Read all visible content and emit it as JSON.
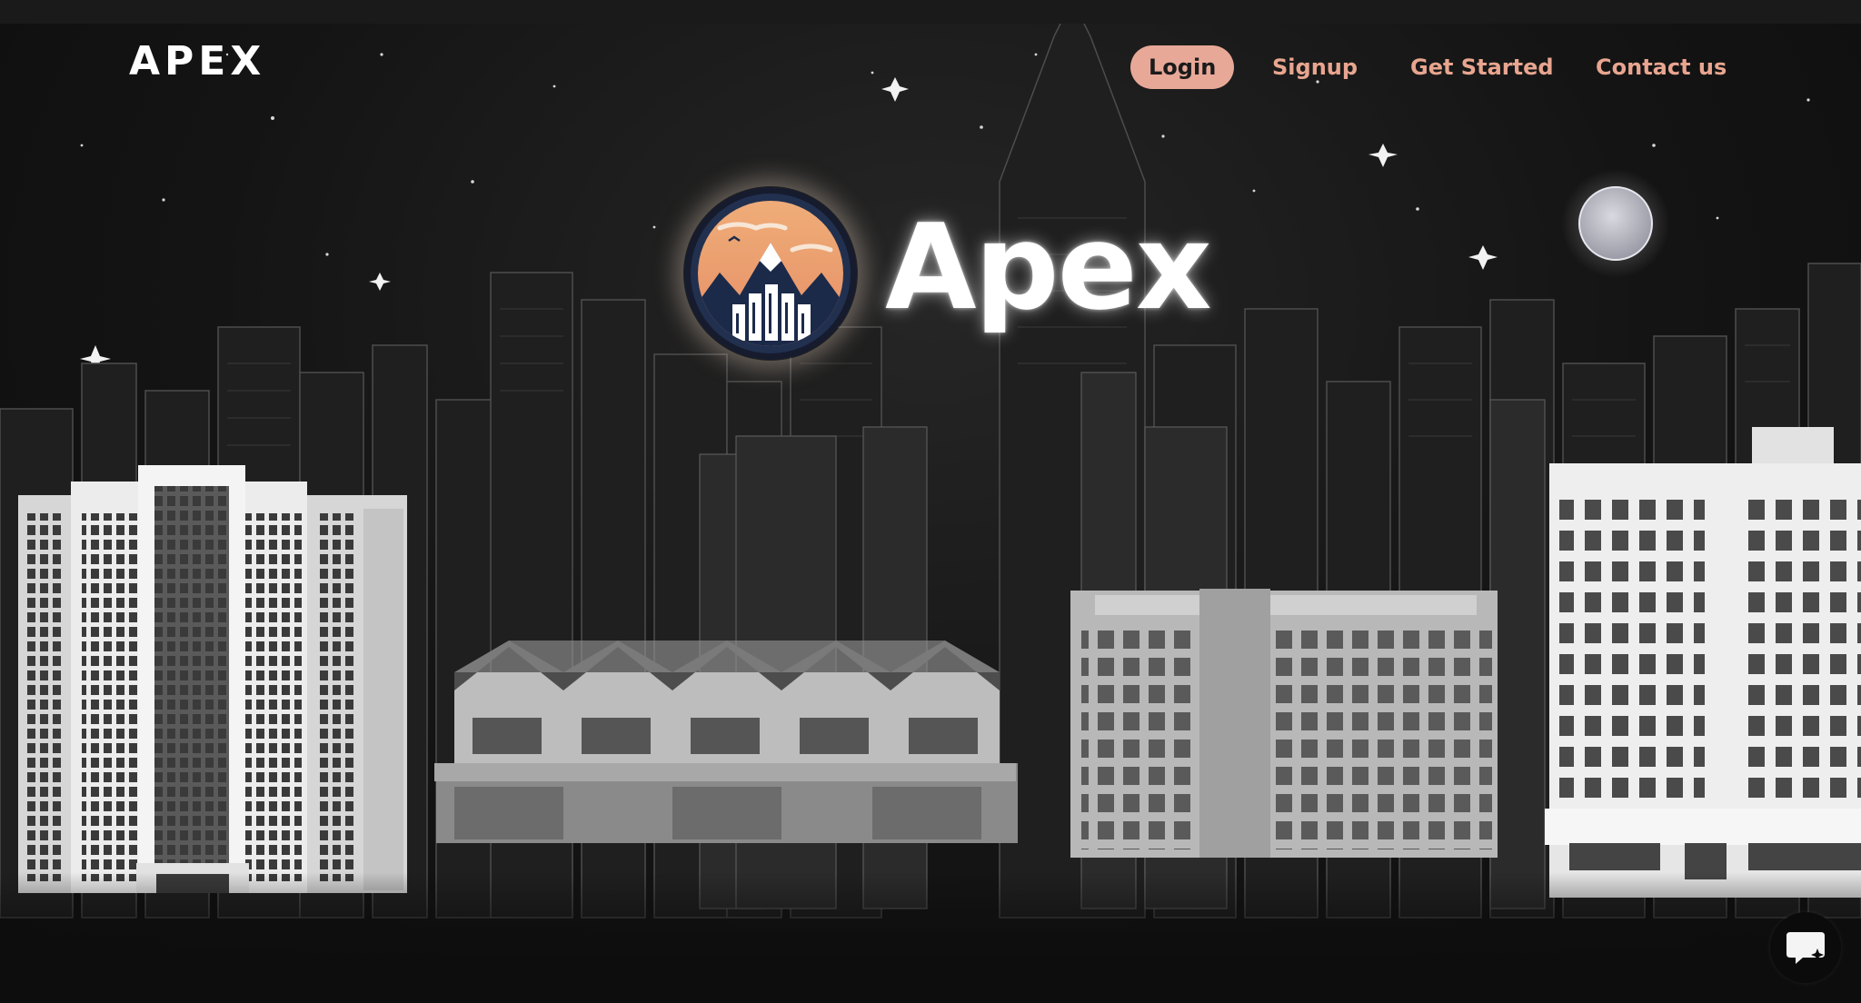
{
  "brand": {
    "name": "APEX"
  },
  "nav": {
    "login": "Login",
    "signup": "Signup",
    "get_started": "Get Started",
    "contact": "Contact us"
  },
  "hero": {
    "title": "Apex"
  },
  "icons": {
    "chat": "chat-bubble-sparkle-icon",
    "logo": "mountain-city-sunset-logo",
    "moon": "moon-icon"
  },
  "colors": {
    "background": "#141414",
    "nav_accent": "#e8a58f",
    "login_pill": "#e8a898",
    "logo_sunset": "#e9986e",
    "logo_ring": "#1c2a4a"
  }
}
